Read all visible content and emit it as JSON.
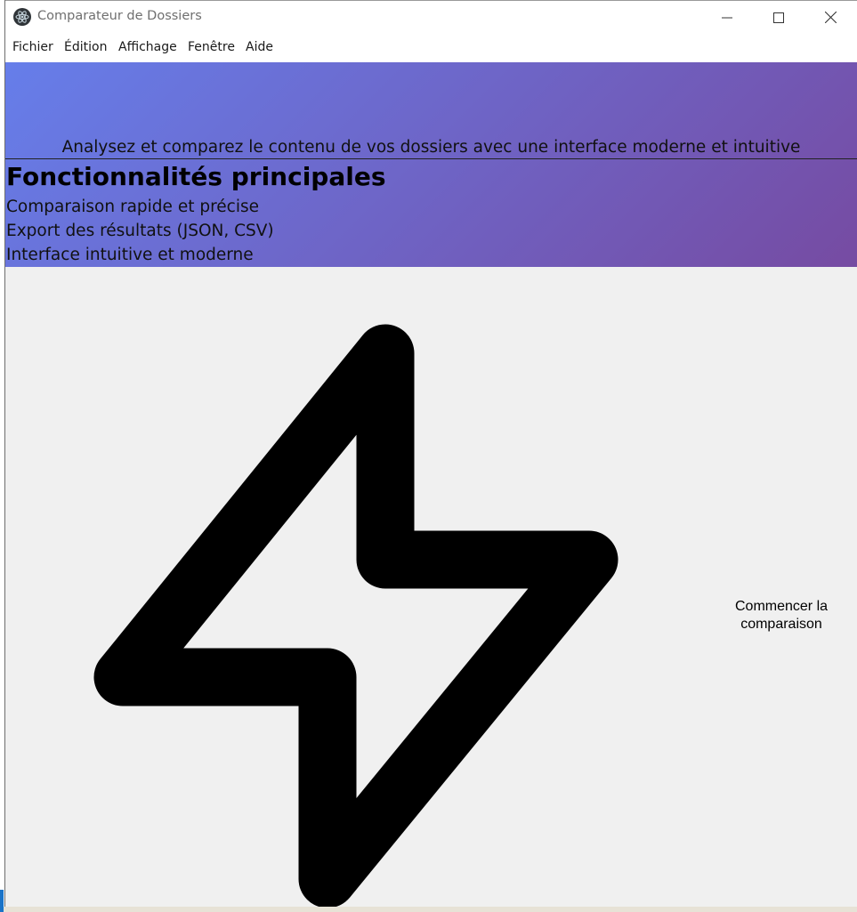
{
  "window": {
    "title": "Comparateur de Dossiers",
    "icon": "electron-app-icon",
    "controls": {
      "minimize_icon": "minimize-icon",
      "maximize_icon": "maximize-icon",
      "close_icon": "close-icon"
    }
  },
  "menubar": {
    "items": [
      {
        "label": "Fichier"
      },
      {
        "label": "Édition"
      },
      {
        "label": "Affichage"
      },
      {
        "label": "Fenêtre"
      },
      {
        "label": "Aide"
      }
    ]
  },
  "hero": {
    "subtitle": "Analysez et comparez le contenu de vos dossiers avec une interface moderne et intuitive",
    "gradient_start": "#667eea",
    "gradient_end": "#764ba2"
  },
  "features": {
    "title": "Fonctionnalités principales",
    "items": [
      {
        "label": "Comparaison rapide et précise"
      },
      {
        "label": "Export des résultats (JSON, CSV)"
      },
      {
        "label": "Interface intuitive et moderne"
      }
    ]
  },
  "main": {
    "icon": "lightning-bolt-icon",
    "start_button": {
      "label_line1": "Commencer la",
      "label_line2": "comparaison"
    }
  }
}
